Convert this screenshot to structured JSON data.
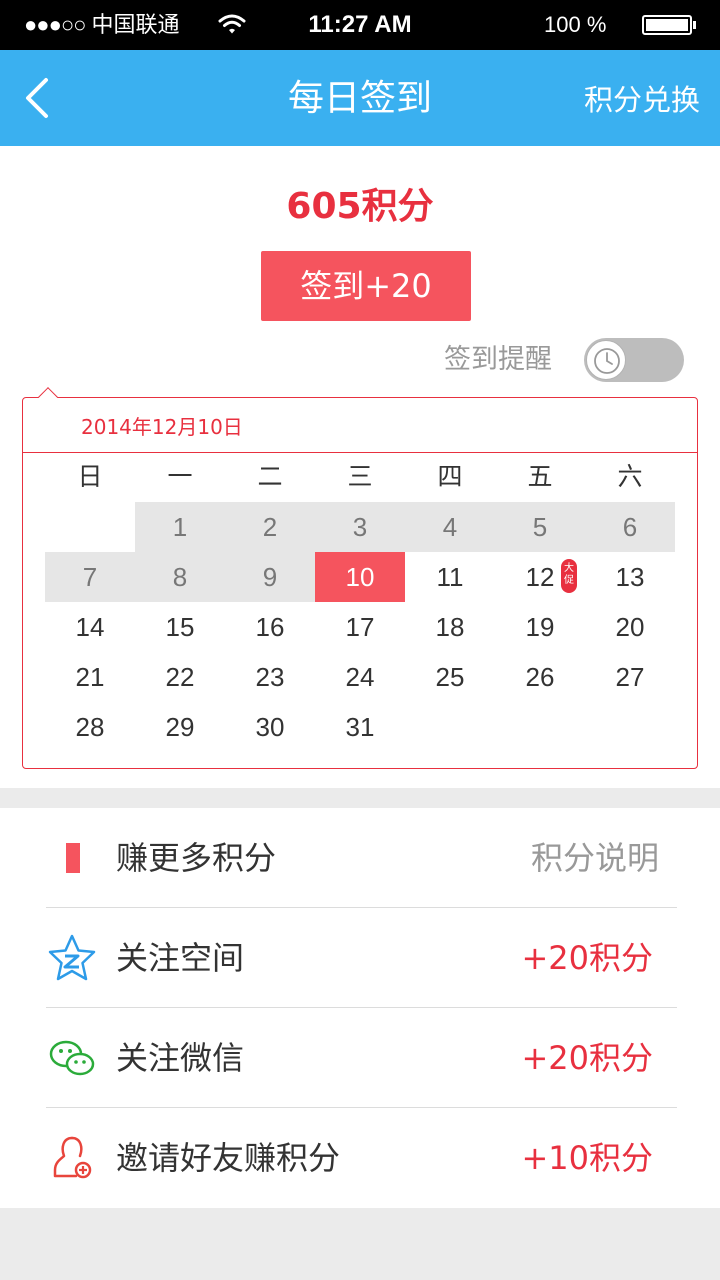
{
  "status_bar": {
    "signal_dots": "●●●○○",
    "carrier": "中国联通",
    "time": "11:27 AM",
    "battery_text": "100 %"
  },
  "nav": {
    "back_icon": "chevron-left-icon",
    "title": "每日签到",
    "right_action": "积分兑换",
    "background": "#3ab0f0"
  },
  "summary": {
    "points": "605积分",
    "signin_button": "签到+20",
    "reminder_label": "签到提醒",
    "reminder_enabled": false
  },
  "calendar": {
    "date_label": "2014年12月10日",
    "weekdays": [
      "日",
      "一",
      "二",
      "三",
      "四",
      "五",
      "六"
    ],
    "days": [
      "1",
      "2",
      "3",
      "4",
      "5",
      "6",
      "7",
      "8",
      "9",
      "10",
      "11",
      "12",
      "13",
      "14",
      "15",
      "16",
      "17",
      "18",
      "19",
      "20",
      "21",
      "22",
      "23",
      "24",
      "25",
      "26",
      "27",
      "28",
      "29",
      "30",
      "31"
    ],
    "signed_days": [
      1,
      2,
      3,
      4,
      5,
      6,
      7,
      8,
      9
    ],
    "today": 10,
    "promo_day": 12,
    "promo_badge": "大促"
  },
  "earn_list": {
    "header": {
      "label": "赚更多积分",
      "link": "积分说明"
    },
    "items": [
      {
        "label": "关注空间",
        "reward": "+20积分",
        "icon": "qzone-star-icon"
      },
      {
        "label": "关注微信",
        "reward": "+20积分",
        "icon": "wechat-icon"
      },
      {
        "label": "邀请好友赚积分",
        "reward": "+10积分",
        "icon": "invite-friend-icon"
      }
    ]
  },
  "colors": {
    "accent_red": "#e8303f",
    "button_red": "#f5545e",
    "nav_blue": "#3ab0f0",
    "signed_day_bg": "#e6e6e6"
  }
}
